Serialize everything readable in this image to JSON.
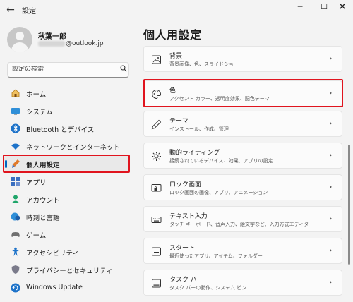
{
  "app": {
    "title": "設定"
  },
  "user": {
    "name": "秋葉一郎",
    "email_domain": "@outlook.jp"
  },
  "search": {
    "placeholder": "設定の検索"
  },
  "sidebar": {
    "items": [
      {
        "label": "ホーム",
        "icon": "home-icon"
      },
      {
        "label": "システム",
        "icon": "system-icon"
      },
      {
        "label": "Bluetooth とデバイス",
        "icon": "bluetooth-icon"
      },
      {
        "label": "ネットワークとインターネット",
        "icon": "wifi-icon"
      },
      {
        "label": "個人用設定",
        "icon": "brush-icon",
        "active": true
      },
      {
        "label": "アプリ",
        "icon": "apps-icon"
      },
      {
        "label": "アカウント",
        "icon": "account-icon"
      },
      {
        "label": "時刻と言語",
        "icon": "time-language-icon"
      },
      {
        "label": "ゲーム",
        "icon": "gaming-icon"
      },
      {
        "label": "アクセシビリティ",
        "icon": "accessibility-icon"
      },
      {
        "label": "プライバシーとセキュリティ",
        "icon": "shield-icon"
      },
      {
        "label": "Windows Update",
        "icon": "update-icon"
      }
    ]
  },
  "main": {
    "title": "個人用設定",
    "cards": [
      {
        "title": "背景",
        "desc": "背景画像、色、スライドショー",
        "icon": "picture-icon"
      },
      {
        "title": "色",
        "desc": "アクセント カラー、透明度効果、配色テーマ",
        "icon": "palette-icon"
      },
      {
        "title": "テーマ",
        "desc": "インストール、作成、管理",
        "icon": "pen-icon"
      },
      {
        "title": "動的ライティング",
        "desc": "接続されているデバイス、効果、アプリの設定",
        "icon": "lighting-icon"
      },
      {
        "title": "ロック画面",
        "desc": "ロック画面の画像、アプリ、アニメーション",
        "icon": "lock-screen-icon"
      },
      {
        "title": "テキスト入力",
        "desc": "タッチ キーボード、音声入力、絵文字など、入力方式エディター",
        "icon": "keyboard-icon"
      },
      {
        "title": "スタート",
        "desc": "最近使ったアプリ、アイテム、フォルダー",
        "icon": "start-icon"
      },
      {
        "title": "タスク バー",
        "desc": "タスク バーの動作、システム ピン",
        "icon": "taskbar-icon"
      }
    ]
  },
  "colors": {
    "highlight": "#e0141e",
    "accent": "#0067c0"
  }
}
